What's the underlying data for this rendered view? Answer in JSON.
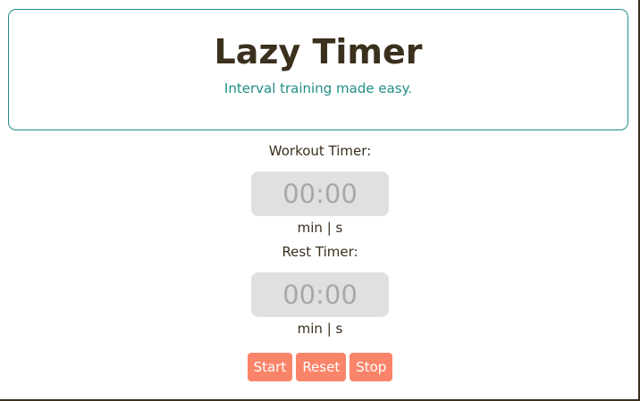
{
  "header": {
    "title": "Lazy Timer",
    "subtitle": "Interval training made easy."
  },
  "workout": {
    "label": "Workout Timer:",
    "value": "00:00",
    "units": "min | s"
  },
  "rest": {
    "label": "Rest Timer:",
    "value": "00:00",
    "units": "min | s"
  },
  "controls": {
    "start_label": "Start",
    "reset_label": "Reset",
    "stop_label": "Stop"
  },
  "colors": {
    "accent": "#1f8f84",
    "button": "#f98469",
    "text": "#3b2f1e",
    "display_bg": "#e0e0e0",
    "display_text": "#a8a8a8"
  }
}
